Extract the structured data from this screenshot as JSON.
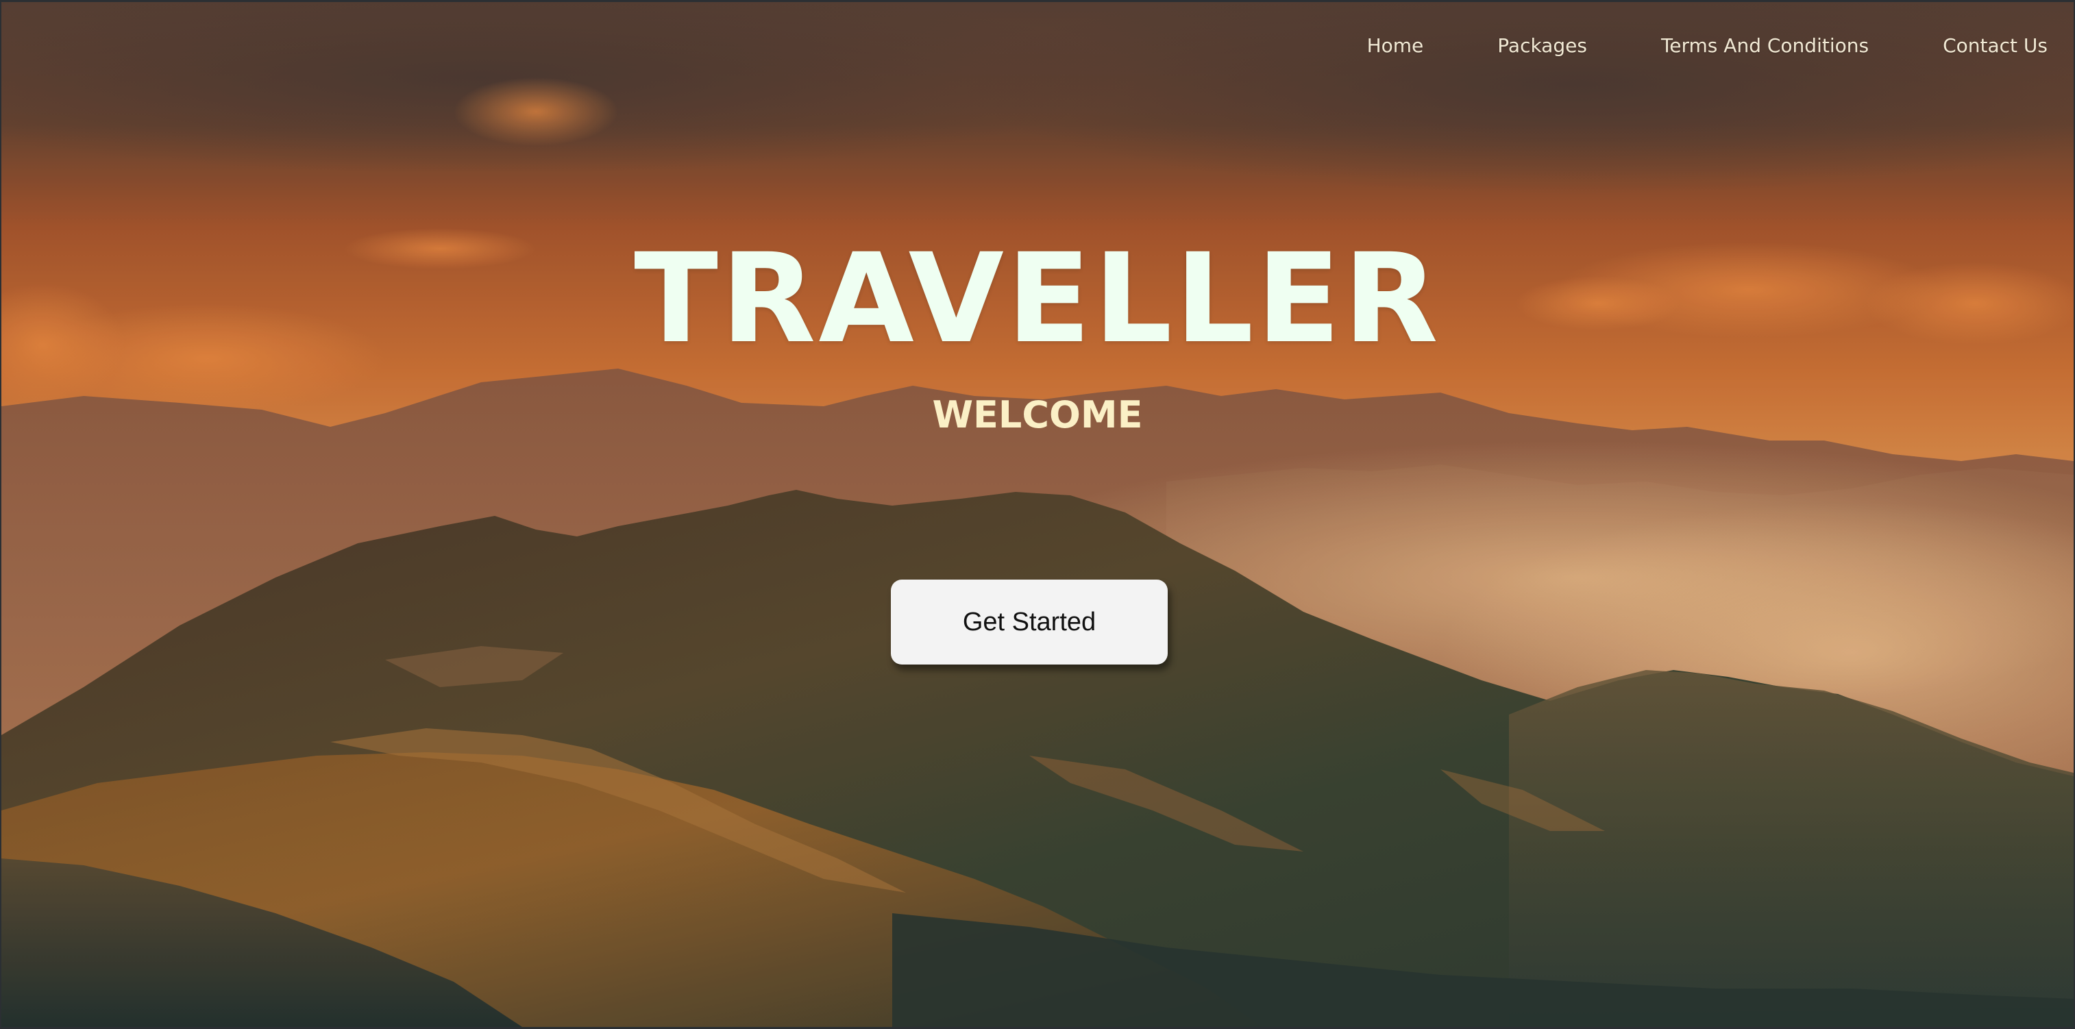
{
  "nav": {
    "items": [
      {
        "label": "Home"
      },
      {
        "label": "Packages"
      },
      {
        "label": "Terms And Conditions"
      },
      {
        "label": "Contact Us"
      }
    ]
  },
  "hero": {
    "title": "TRAVELLER",
    "subtitle": "WELCOME",
    "cta_label": "Get Started",
    "background": "mountain-sunset-photo"
  },
  "colors": {
    "title": "#effff2",
    "subtitle": "#fbf0c6",
    "nav_text": "#f1e9d4",
    "sky": "#c86a32",
    "button_bg": "#f3f3f3"
  }
}
